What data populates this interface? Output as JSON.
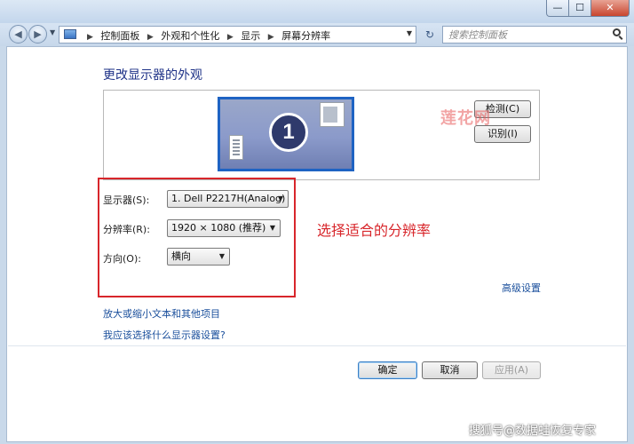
{
  "window": {
    "min_glyph": "—",
    "max_glyph": "☐",
    "close_glyph": "✕"
  },
  "address_bar": {
    "breadcrumbs": [
      "控制面板",
      "外观和个性化",
      "显示",
      "屏幕分辨率"
    ],
    "search_placeholder": "搜索控制面板"
  },
  "page": {
    "title": "更改显示器的外观",
    "monitor_number": "1",
    "detect_button": "检测(C)",
    "identify_button": "识别(I)",
    "watermark_overlay": "莲花网"
  },
  "settings": {
    "display_label": "显示器(S):",
    "display_value": "1. Dell P2217H(Analog)",
    "resolution_label": "分辨率(R):",
    "resolution_value": "1920 × 1080 (推荐)",
    "orientation_label": "方向(O):",
    "orientation_value": "横向"
  },
  "annotation": "选择适合的分辨率",
  "links": {
    "advanced": "高级设置",
    "text_size": "放大或缩小文本和其他项目",
    "which_settings": "我应该选择什么显示器设置?"
  },
  "dialog_buttons": {
    "ok": "确定",
    "cancel": "取消",
    "apply": "应用(A)"
  },
  "footer_watermark": "搜狐号@数据蛙恢复专家"
}
